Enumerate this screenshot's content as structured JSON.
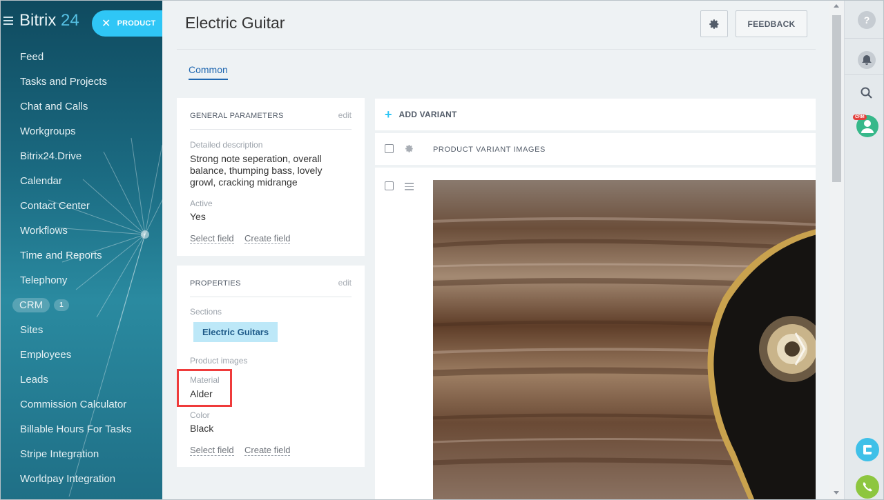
{
  "sidebar": {
    "brand_name": "Bitrix",
    "brand_num": "24",
    "product_label": "PRODUCT",
    "items": [
      {
        "label": "Feed"
      },
      {
        "label": "Tasks and Projects"
      },
      {
        "label": "Chat and Calls"
      },
      {
        "label": "Workgroups"
      },
      {
        "label": "Bitrix24.Drive"
      },
      {
        "label": "Calendar"
      },
      {
        "label": "Contact Center"
      },
      {
        "label": "Workflows"
      },
      {
        "label": "Time and Reports"
      },
      {
        "label": "Telephony"
      },
      {
        "label": "CRM",
        "count": "1"
      },
      {
        "label": "Sites"
      },
      {
        "label": "Employees"
      },
      {
        "label": "Leads"
      },
      {
        "label": "Commission Calculator"
      },
      {
        "label": "Billable Hours For Tasks"
      },
      {
        "label": "Stripe Integration"
      },
      {
        "label": "Worldpay Integration"
      }
    ]
  },
  "header": {
    "title": "Electric Guitar",
    "feedback_label": "FEEDBACK",
    "tab_common": "Common"
  },
  "general": {
    "title": "GENERAL PARAMETERS",
    "edit": "edit",
    "description_label": "Detailed description",
    "description_value": "Strong note seperation, overall balance, thumping bass, lovely growl, cracking midrange",
    "active_label": "Active",
    "active_value": "Yes",
    "select_field": "Select field",
    "create_field": "Create field"
  },
  "properties": {
    "title": "PROPERTIES",
    "edit": "edit",
    "sections_label": "Sections",
    "section_chip": "Electric Guitars",
    "images_label": "Product images",
    "material_label": "Material",
    "material_value": "Alder",
    "color_label": "Color",
    "color_value": "Black",
    "select_field": "Select field",
    "create_field": "Create field"
  },
  "variants": {
    "add_label": "ADD VARIANT",
    "column_images": "PRODUCT VARIANT IMAGES"
  },
  "rightbar": {
    "help": "?",
    "crm_tag": "CRM"
  },
  "colors": {
    "accent": "#2fc6f6",
    "highlight": "#ef3b3b",
    "link": "#2067b0"
  }
}
